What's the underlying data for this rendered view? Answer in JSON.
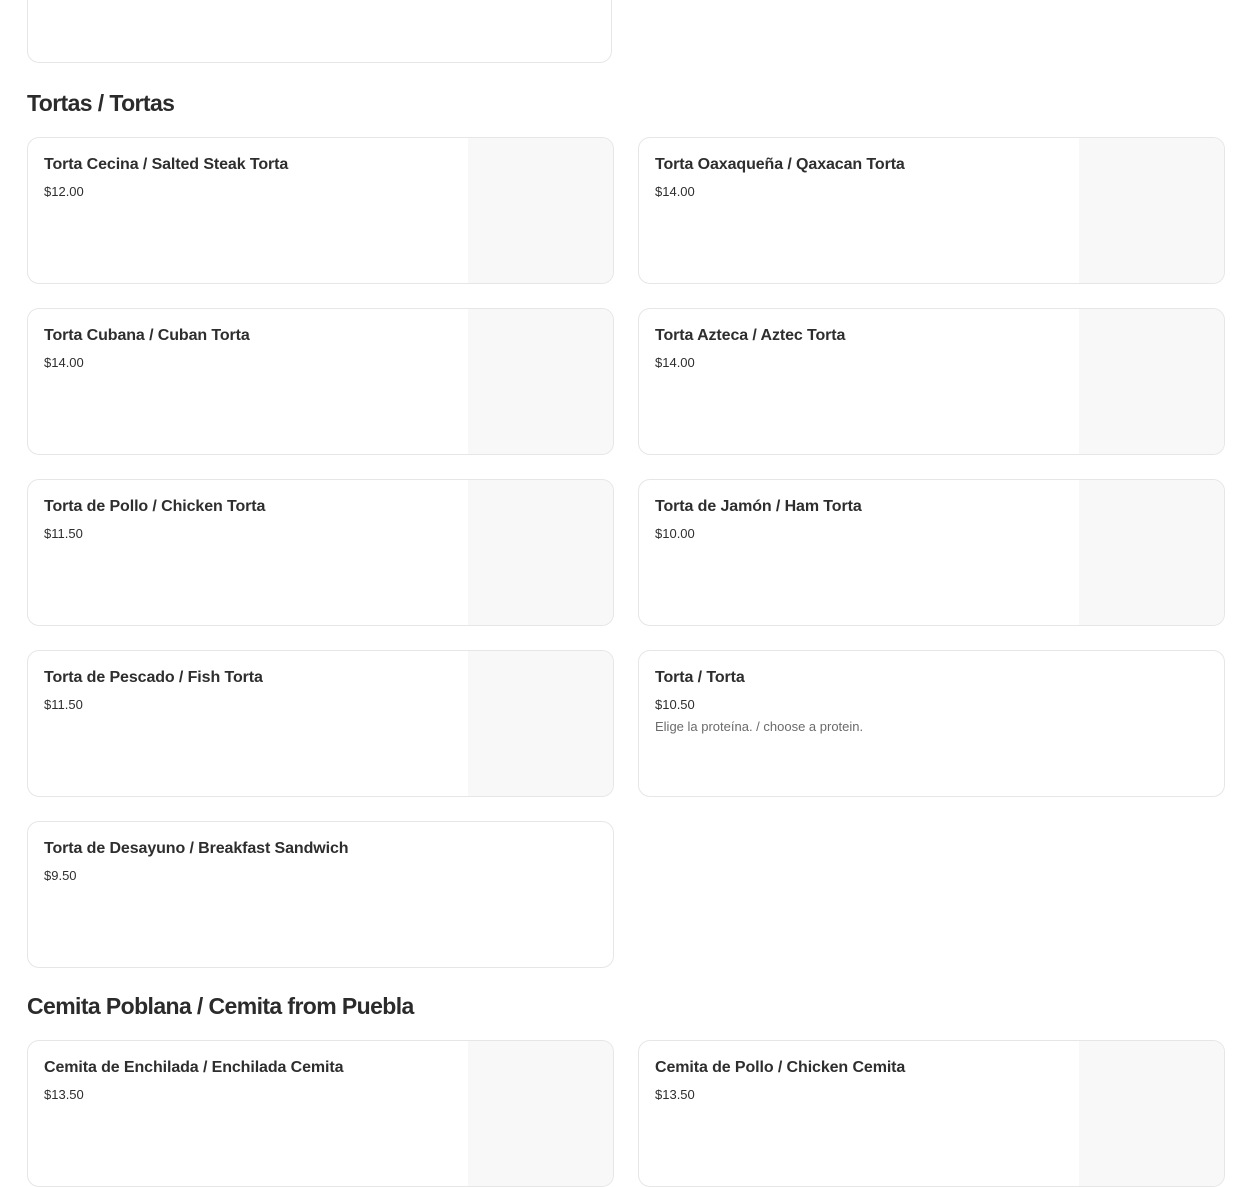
{
  "sections": [
    {
      "title": "Tortas / Tortas",
      "items": [
        {
          "name": "Torta Cecina / Salted Steak Torta",
          "price": "$12.00"
        },
        {
          "name": "Torta Oaxaqueña / Qaxacan Torta",
          "price": "$14.00"
        },
        {
          "name": "Torta Cubana / Cuban Torta",
          "price": "$14.00"
        },
        {
          "name": "Torta Azteca / Aztec Torta",
          "price": "$14.00"
        },
        {
          "name": "Torta de Pollo / Chicken Torta",
          "price": "$11.50"
        },
        {
          "name": "Torta de Jamón / Ham Torta",
          "price": "$10.00"
        },
        {
          "name": "Torta de Pescado / Fish Torta",
          "price": "$11.50"
        },
        {
          "name": "Torta / Torta",
          "price": "$10.50",
          "description": "Elige la proteína. / choose a protein."
        },
        {
          "name": "Torta de Desayuno / Breakfast Sandwich",
          "price": "$9.50"
        }
      ]
    },
    {
      "title": "Cemita Poblana / Cemita from Puebla",
      "items": [
        {
          "name": "Cemita de Enchilada / Enchilada Cemita",
          "price": "$13.50"
        },
        {
          "name": "Cemita de Pollo / Chicken Cemita",
          "price": "$13.50"
        }
      ]
    }
  ]
}
